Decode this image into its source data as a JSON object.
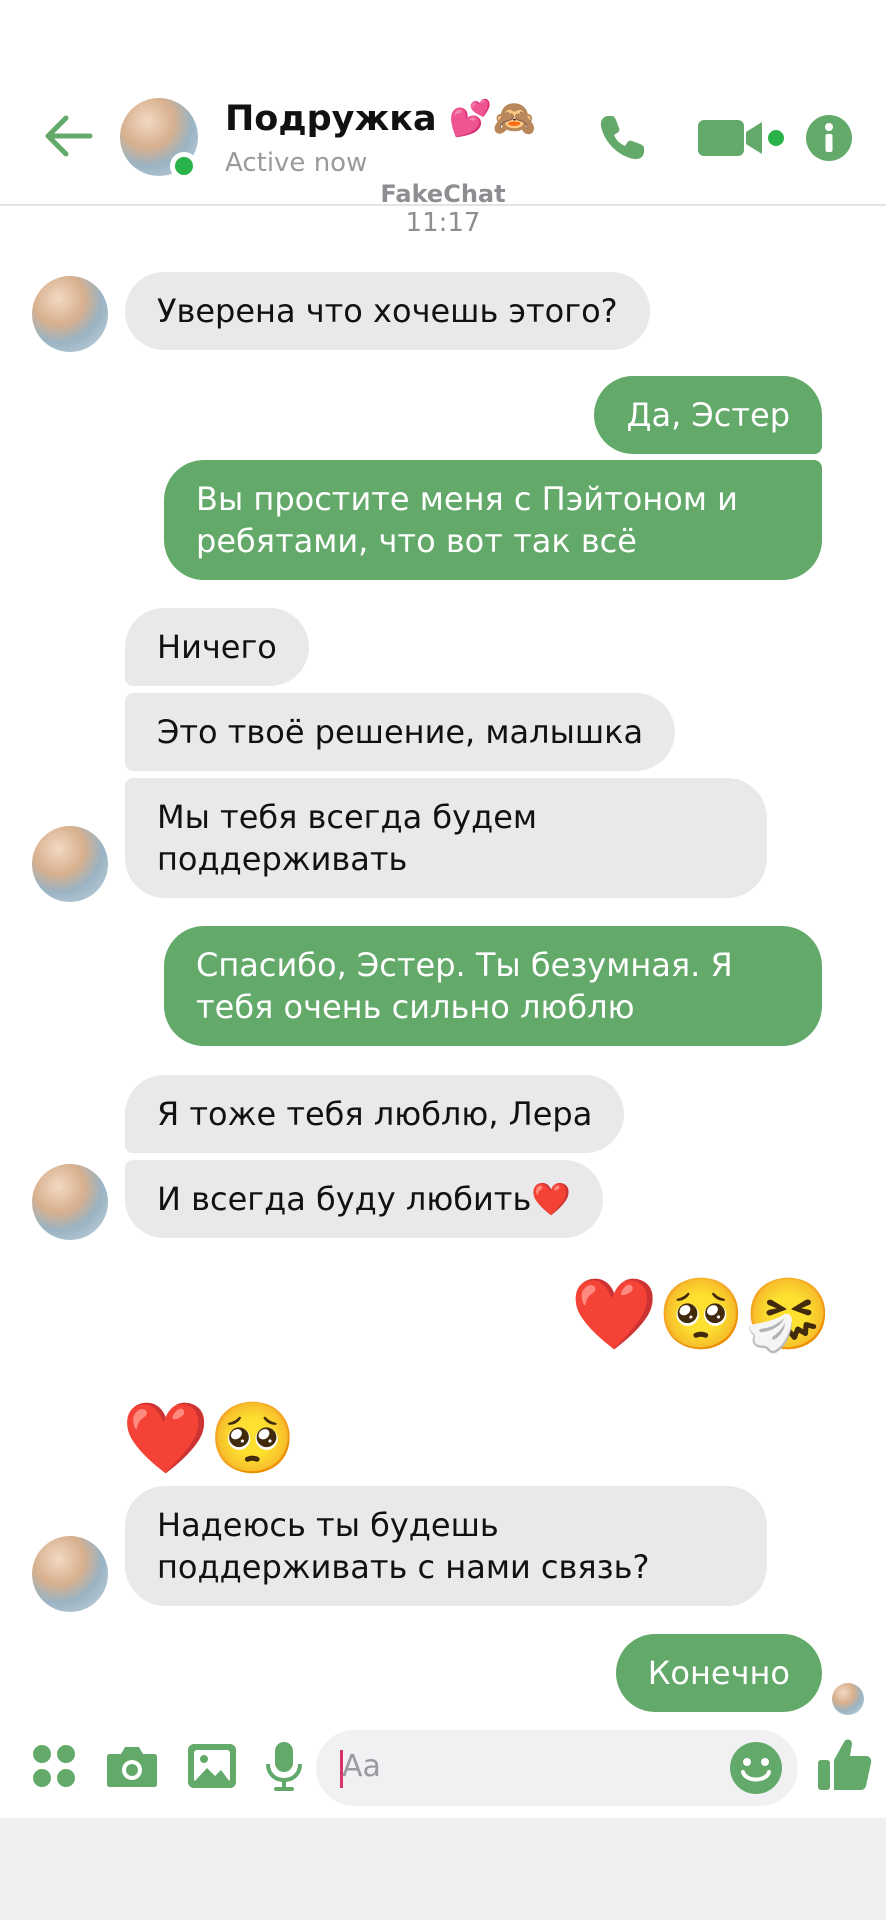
{
  "header": {
    "contact_name": "Подружка 💕🙈",
    "status": "Active now"
  },
  "watermark": "FakeChat",
  "timestamp": "11:17",
  "messages": [
    {
      "side": "in",
      "text": "Уверена что хочешь этого?"
    },
    {
      "side": "out",
      "text": "Да, Эстер"
    },
    {
      "side": "out",
      "text": "Вы простите меня с Пэйтоном и ребятами,  что вот так всё"
    },
    {
      "side": "in",
      "text": "Ничего"
    },
    {
      "side": "in",
      "text": "Это твоё решение, малышка"
    },
    {
      "side": "in",
      "text": "Мы тебя всегда будем поддерживать"
    },
    {
      "side": "out",
      "text": "Спасибо, Эстер. Ты безумная. Я тебя очень сильно люблю"
    },
    {
      "side": "in",
      "text": "Я тоже тебя люблю, Лера"
    },
    {
      "side": "in",
      "text": "И всегда буду любить❤️"
    },
    {
      "side": "out",
      "text": "❤️🥺🤧"
    },
    {
      "side": "in",
      "text": "❤️🥺"
    },
    {
      "side": "in",
      "text": "Надеюсь ты будешь поддерживать с нами связь?"
    },
    {
      "side": "out",
      "text": "Конечно"
    }
  ],
  "composer": {
    "placeholder": "Aa"
  },
  "colors": {
    "accent": "#63a96a",
    "incoming_bubble": "#e9e9eb",
    "online": "#2ab34a"
  },
  "icons": [
    "back-arrow-icon",
    "phone-icon",
    "video-camera-icon",
    "info-icon",
    "apps-grid-icon",
    "camera-icon",
    "image-icon",
    "microphone-icon",
    "emoji-smile-icon",
    "thumbs-up-icon"
  ]
}
